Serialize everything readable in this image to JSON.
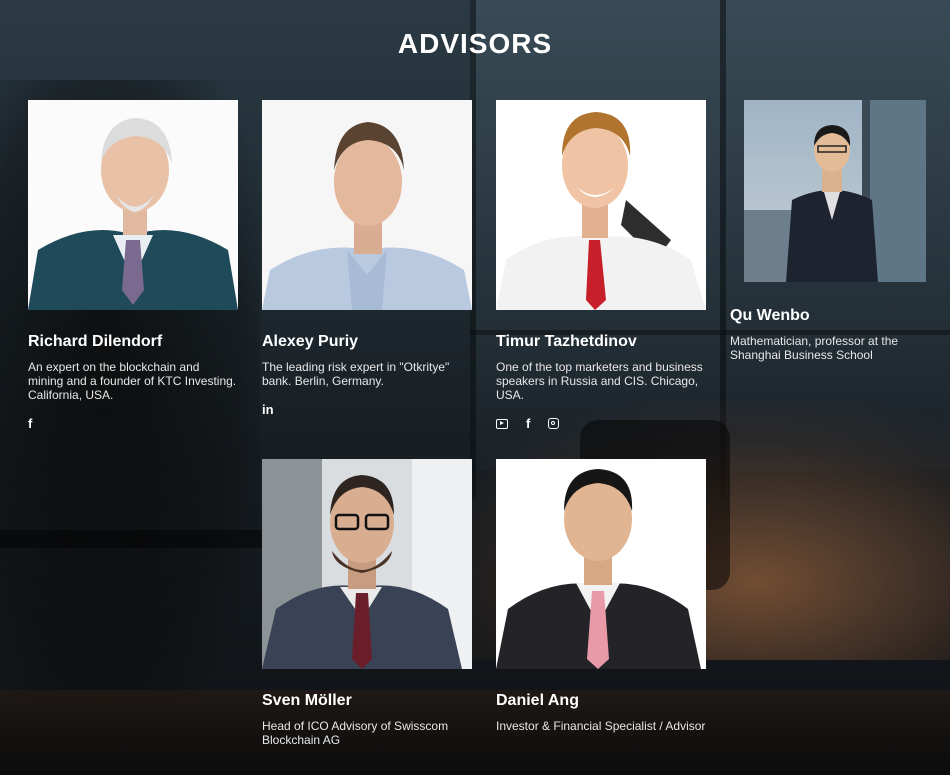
{
  "section": {
    "title": "ADVISORS"
  },
  "advisors": [
    {
      "name": "Richard Dilendorf",
      "description": "An expert on the blockchain and mining and a founder of KTC Investing. California, USA.",
      "social": [
        "facebook"
      ]
    },
    {
      "name": "Alexey Puriy",
      "description": "The leading risk expert in \"Otkritye\" bank. Berlin, Germany.",
      "social": [
        "linkedin"
      ]
    },
    {
      "name": "Timur Tazhetdinov",
      "description": "One of the top marketers and business speakers in Russia and CIS. Chicago, USA.",
      "social": [
        "youtube",
        "facebook",
        "instagram"
      ]
    },
    {
      "name": "Qu Wenbo",
      "description": "Mathematician, professor at the Shanghai Business School",
      "social": []
    },
    {
      "name": "Sven Möller",
      "description": "Head of ICO Advisory of Swisscom Blockchain AG",
      "social": []
    },
    {
      "name": "Daniel Ang",
      "description": "Investor & Financial Specialist / Advisor",
      "social": []
    }
  ],
  "icons": {
    "facebook": "f",
    "linkedin": "in"
  }
}
